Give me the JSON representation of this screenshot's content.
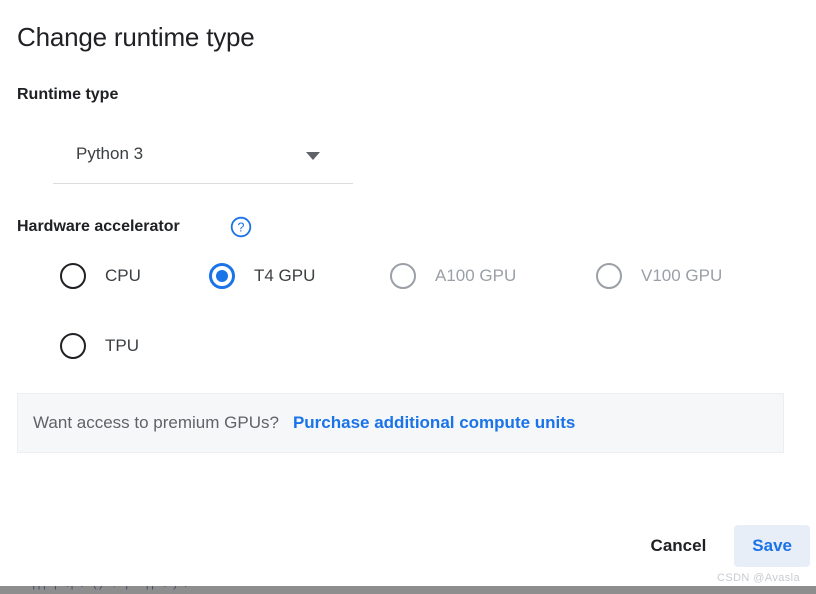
{
  "dialog": {
    "title": "Change runtime type",
    "runtime_type": {
      "label": "Runtime type",
      "selected": "Python 3",
      "options": [
        "Python 3"
      ],
      "dropdown_icon": "chevron-down-icon"
    },
    "hardware_accelerator": {
      "label": "Hardware accelerator",
      "help_icon": "help-circle-icon",
      "options": [
        {
          "label": "CPU",
          "selected": false,
          "disabled": false
        },
        {
          "label": "T4 GPU",
          "selected": true,
          "disabled": false
        },
        {
          "label": "A100 GPU",
          "selected": false,
          "disabled": true
        },
        {
          "label": "V100 GPU",
          "selected": false,
          "disabled": true
        },
        {
          "label": "TPU",
          "selected": false,
          "disabled": false
        }
      ]
    },
    "premium_banner": {
      "text": "Want access to premium GPUs?",
      "link_label": "Purchase additional compute units"
    },
    "actions": {
      "cancel_label": "Cancel",
      "save_label": "Save"
    }
  },
  "watermark": "CSDN @Avasla",
  "bottom_strip": {
    "text": "||| | \\| /  ()     ↑      | ⌐|| \\ ) /"
  },
  "colors": {
    "accent_blue": "#1a73e8",
    "text_primary": "#202124",
    "text_secondary": "#3c4043",
    "text_muted": "#5f6368",
    "disabled_grey": "#9aa0a6",
    "banner_bg": "#f6f7f8",
    "save_bg": "#e8eef8"
  }
}
